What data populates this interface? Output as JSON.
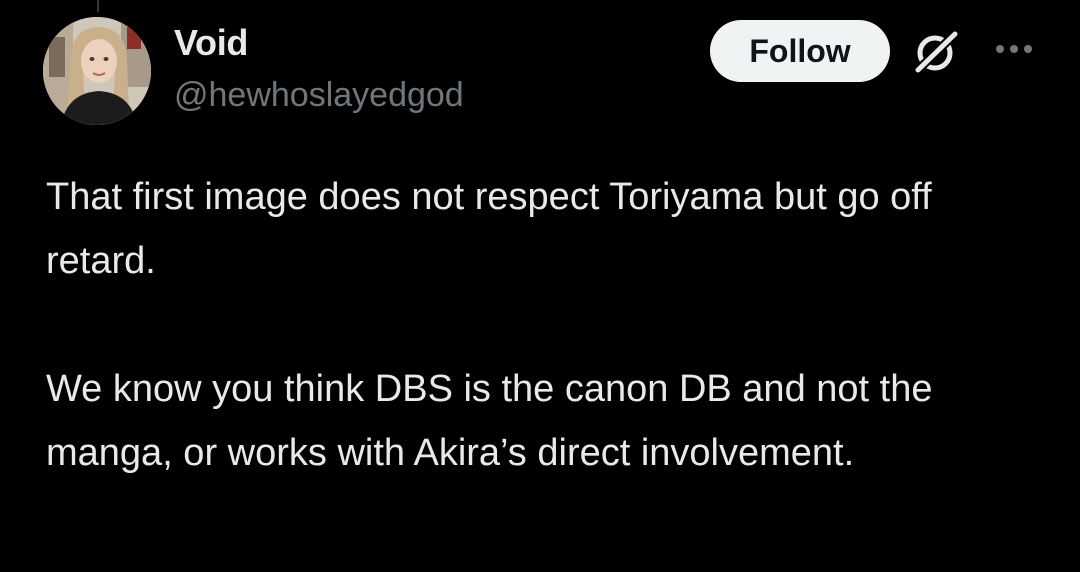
{
  "post": {
    "author": {
      "display_name": "Void",
      "handle": "@hewhoslayedgod"
    },
    "follow_label": "Follow",
    "icons": {
      "grok": "grok-icon",
      "more": "more-icon"
    },
    "paragraphs": [
      "That first image does not respect Toriyama but go off retard.",
      "We know you think DBS is the canon DB and not the manga, or works with Akira’s direct involvement."
    ]
  },
  "colors": {
    "background": "#000000",
    "primary_text": "#e7e9ea",
    "secondary_text": "#71767b",
    "follow_bg": "#eff3f4",
    "follow_text": "#0f1419"
  }
}
